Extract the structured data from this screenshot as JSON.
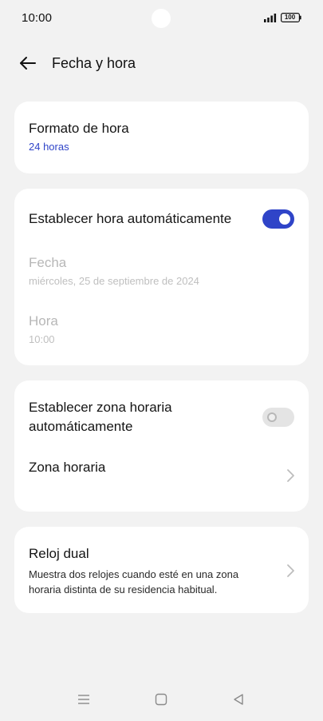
{
  "status_bar": {
    "time": "10:00",
    "battery": "100",
    "signal_icon": "signal-icon",
    "battery_icon": "battery-icon"
  },
  "header": {
    "title": "Fecha y hora",
    "back_icon": "back-arrow-icon"
  },
  "sections": {
    "time_format": {
      "title": "Formato de hora",
      "value": "24 horas"
    },
    "auto_time": {
      "title": "Establecer hora automáticamente",
      "toggle_on": true,
      "date_title": "Fecha",
      "date_value": "miércoles, 25 de septiembre de 2024",
      "time_title": "Hora",
      "time_value": "10:00"
    },
    "timezone": {
      "auto_title_line1": "Establecer zona horaria",
      "auto_title_line2": "automáticamente",
      "toggle_on": false,
      "zone_title": "Zona horaria",
      "chevron_icon": "chevron-right-icon"
    },
    "dual_clock": {
      "title": "Reloj dual",
      "description_line1": "Muestra dos relojes cuando esté en una zona",
      "description_line2": "horaria distinta de su residencia habitual.",
      "chevron_icon": "chevron-right-icon"
    }
  },
  "navigation": {
    "menu_icon": "menu-icon",
    "home_icon": "home-square-icon",
    "back_icon": "back-triangle-icon"
  },
  "colors": {
    "accent": "#2f44c8",
    "background": "#f2f2f2",
    "card": "#ffffff",
    "disabled_text": "#b7b7b7"
  }
}
